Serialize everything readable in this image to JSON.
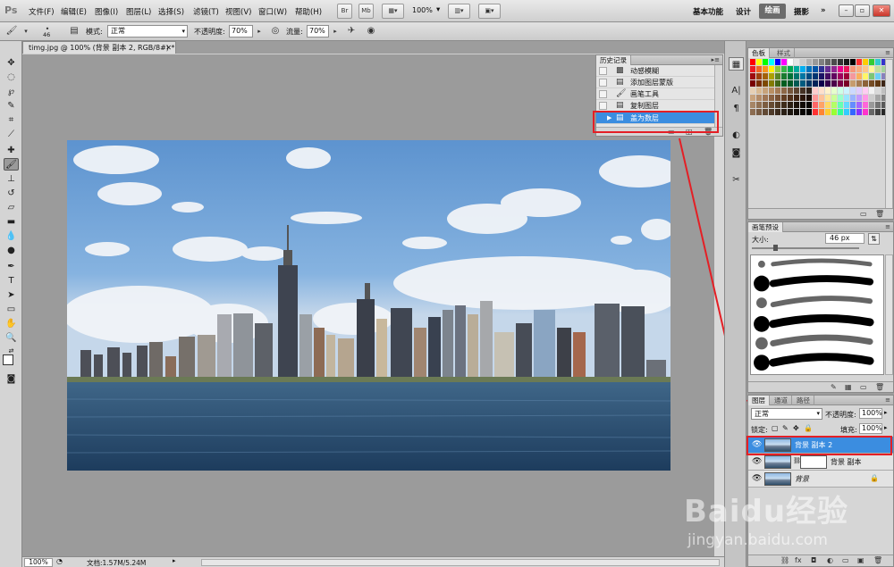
{
  "app": {
    "logo": "Ps"
  },
  "menu": [
    "文件(F)",
    "编辑(E)",
    "图像(I)",
    "图层(L)",
    "选择(S)",
    "滤镜(T)",
    "视图(V)",
    "窗口(W)",
    "帮助(H)"
  ],
  "menubar": {
    "br_label": "Br",
    "mb_label": "Mb",
    "zoom": "100%"
  },
  "workspaces": {
    "items": [
      "基本功能",
      "设计"
    ],
    "active": "绘画",
    "extra": "摄影",
    "more": "»"
  },
  "options": {
    "brush_size": "46",
    "mode_label": "模式:",
    "mode_value": "正常",
    "opacity_label": "不透明度:",
    "opacity_value": "70%",
    "flow_label": "流量:",
    "flow_value": "70%"
  },
  "document": {
    "tab_title": "timg.jpg @ 100% (背景 副本 2, RGB/8#) *",
    "zoom": "100%",
    "doc_info": "文档:1.57M/5.24M"
  },
  "history": {
    "tab": "历史记录",
    "items": [
      {
        "label": "动感模糊",
        "icon": "filter-icon"
      },
      {
        "label": "添加图层蒙版",
        "icon": "mask-icon"
      },
      {
        "label": "画笔工具",
        "icon": "brush-icon"
      },
      {
        "label": "复制图层",
        "icon": "layer-icon"
      },
      {
        "label": "盖为数层",
        "icon": "layer-icon",
        "selected": true
      }
    ]
  },
  "swatches_panel": {
    "tabs": [
      "色板",
      "样式"
    ]
  },
  "brush_panel": {
    "tab": "画笔预设",
    "size_label": "大小:",
    "size_value": "46 px",
    "strokes": 6
  },
  "layers_panel": {
    "tabs": [
      "图层",
      "通道",
      "路径"
    ],
    "blend_mode": "正常",
    "opacity_label": "不透明度:",
    "opacity_value": "100%",
    "lock_label": "锁定:",
    "fill_label": "填充:",
    "fill_value": "100%",
    "layers": [
      {
        "name": "背景 副本 2",
        "selected": true,
        "mask": false
      },
      {
        "name": "背景 副本",
        "selected": false,
        "mask": true
      },
      {
        "name": "背景",
        "selected": false,
        "mask": false,
        "locked": true
      }
    ]
  },
  "watermark": {
    "main": "Baidu经验",
    "sub": "jingyan.baidu.com"
  },
  "colors": {
    "highlight": "#3b8de0",
    "annotation": "#e41f25"
  }
}
